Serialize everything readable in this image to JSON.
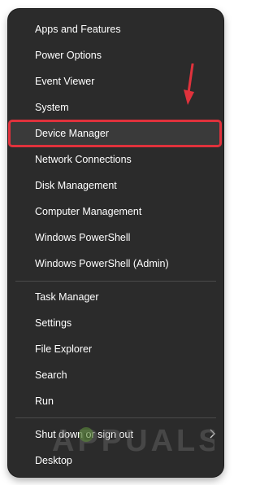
{
  "menu": {
    "items_group1": [
      {
        "label": "Apps and Features"
      },
      {
        "label": "Power Options"
      },
      {
        "label": "Event Viewer"
      },
      {
        "label": "System"
      },
      {
        "label": "Device Manager",
        "highlighted": true
      },
      {
        "label": "Network Connections"
      },
      {
        "label": "Disk Management"
      },
      {
        "label": "Computer Management"
      },
      {
        "label": "Windows PowerShell"
      },
      {
        "label": "Windows PowerShell (Admin)"
      }
    ],
    "items_group2": [
      {
        "label": "Task Manager"
      },
      {
        "label": "Settings"
      },
      {
        "label": "File Explorer"
      },
      {
        "label": "Search"
      },
      {
        "label": "Run"
      }
    ],
    "items_group3": [
      {
        "label": "Shut down or sign out",
        "has_submenu": true
      },
      {
        "label": "Desktop"
      }
    ]
  },
  "annotation": {
    "arrow_color": "#e0323c",
    "highlight_color": "#e0323c"
  },
  "watermark": {
    "text": "APPUALS"
  },
  "colors": {
    "menu_background": "#2b2b2b",
    "text": "#ffffff",
    "divider": "#4a4a4a"
  }
}
